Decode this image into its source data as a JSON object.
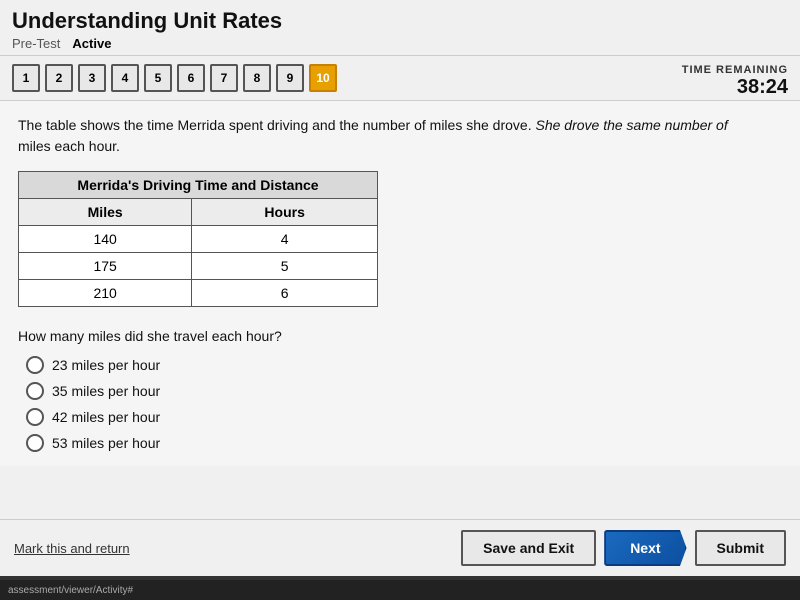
{
  "header": {
    "title": "Understanding Unit Rates",
    "breadcrumb_pretest": "Pre-Test",
    "breadcrumb_active": "Active"
  },
  "timer": {
    "label": "TIME REMAINING",
    "value": "38:24"
  },
  "question_nav": {
    "buttons": [
      "1",
      "2",
      "3",
      "4",
      "5",
      "6",
      "7",
      "8",
      "9",
      "10"
    ],
    "active_index": 9
  },
  "question": {
    "text_part1": "The table shows the time Merrida spent driving and the number of miles she drove.",
    "text_italic": "She drove the same number of",
    "text_part2": "miles each hour.",
    "table_title": "Merrida's Driving Time and Distance",
    "table_col1": "Miles",
    "table_col2": "Hours",
    "table_rows": [
      {
        "col1": "140",
        "col2": "4"
      },
      {
        "col1": "175",
        "col2": "5"
      },
      {
        "col1": "210",
        "col2": "6"
      }
    ],
    "answer_prompt": "How many miles did she travel each hour?",
    "choices": [
      "23 miles per hour",
      "35 miles per hour",
      "42 miles per hour",
      "53 miles per hour"
    ]
  },
  "footer": {
    "mark_link": "Mark this and return",
    "btn_save": "Save and Exit",
    "btn_next": "Next",
    "btn_submit": "Submit"
  },
  "taskbar": {
    "url": "assessment/viewer/Activity#"
  }
}
